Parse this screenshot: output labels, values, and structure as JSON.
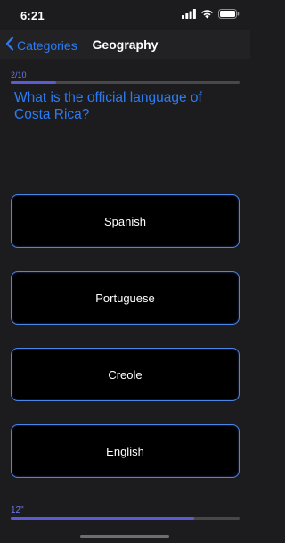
{
  "status_bar": {
    "time": "6:21",
    "icons": [
      "cellular-signal-icon",
      "wifi-icon",
      "battery-icon"
    ]
  },
  "nav": {
    "back_label": "Categories",
    "back_icon": "chevron-left-icon",
    "title": "Geography"
  },
  "progress": {
    "label": "2/10",
    "current": 2,
    "total": 10
  },
  "question": "What is the official language of Costa Rica?",
  "answers": [
    "Spanish",
    "Portuguese",
    "Creole",
    "English"
  ],
  "timer": {
    "label": "12\"",
    "fraction_remaining": 0.8
  },
  "colors": {
    "background": "#1c1c1e",
    "accent_blue": "#2b7cf6",
    "accent_indigo": "#5b5bd6",
    "answer_border": "#4a86e8"
  }
}
